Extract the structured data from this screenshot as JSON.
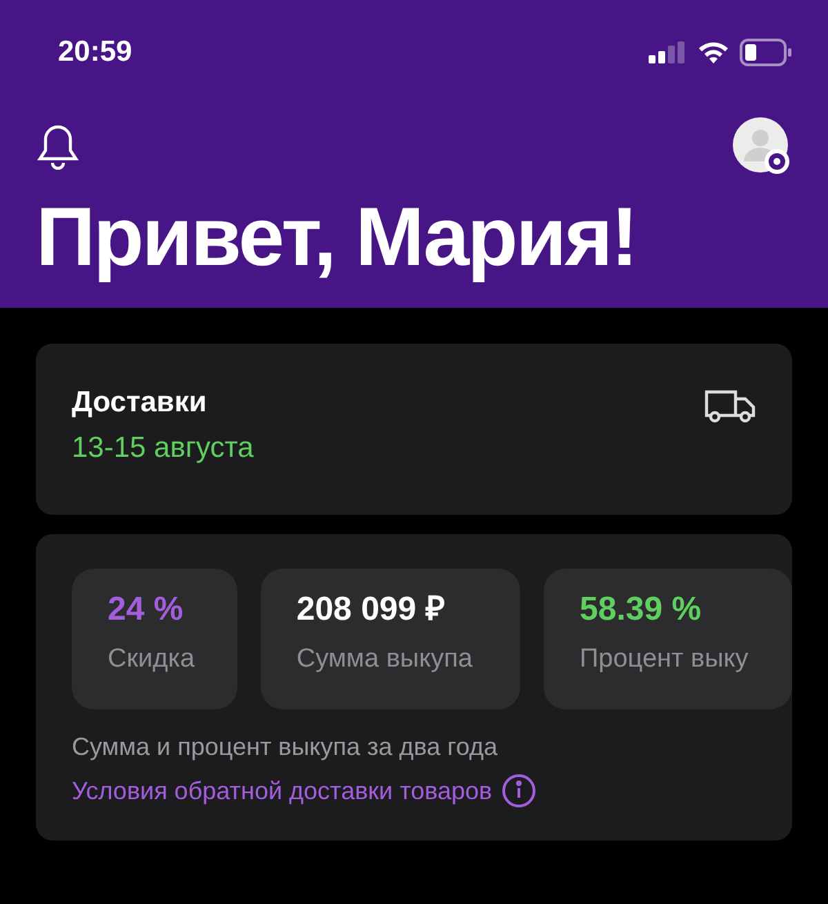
{
  "status_bar": {
    "time": "20:59"
  },
  "header": {
    "greeting": "Привет, Мария!"
  },
  "delivery": {
    "title": "Доставки",
    "dates": "13-15 августа"
  },
  "stats": [
    {
      "value": "24 %",
      "label": "Скидка",
      "color": "#a35ee0"
    },
    {
      "value": "208 099 ₽",
      "label": "Сумма выкупа",
      "color": "#ffffff"
    },
    {
      "value": "58.39 %",
      "label": "Процент выку",
      "color": "#5fcf5f"
    }
  ],
  "note": "Сумма и процент выкупа за два года",
  "link": "Условия обратной доставки товаров"
}
